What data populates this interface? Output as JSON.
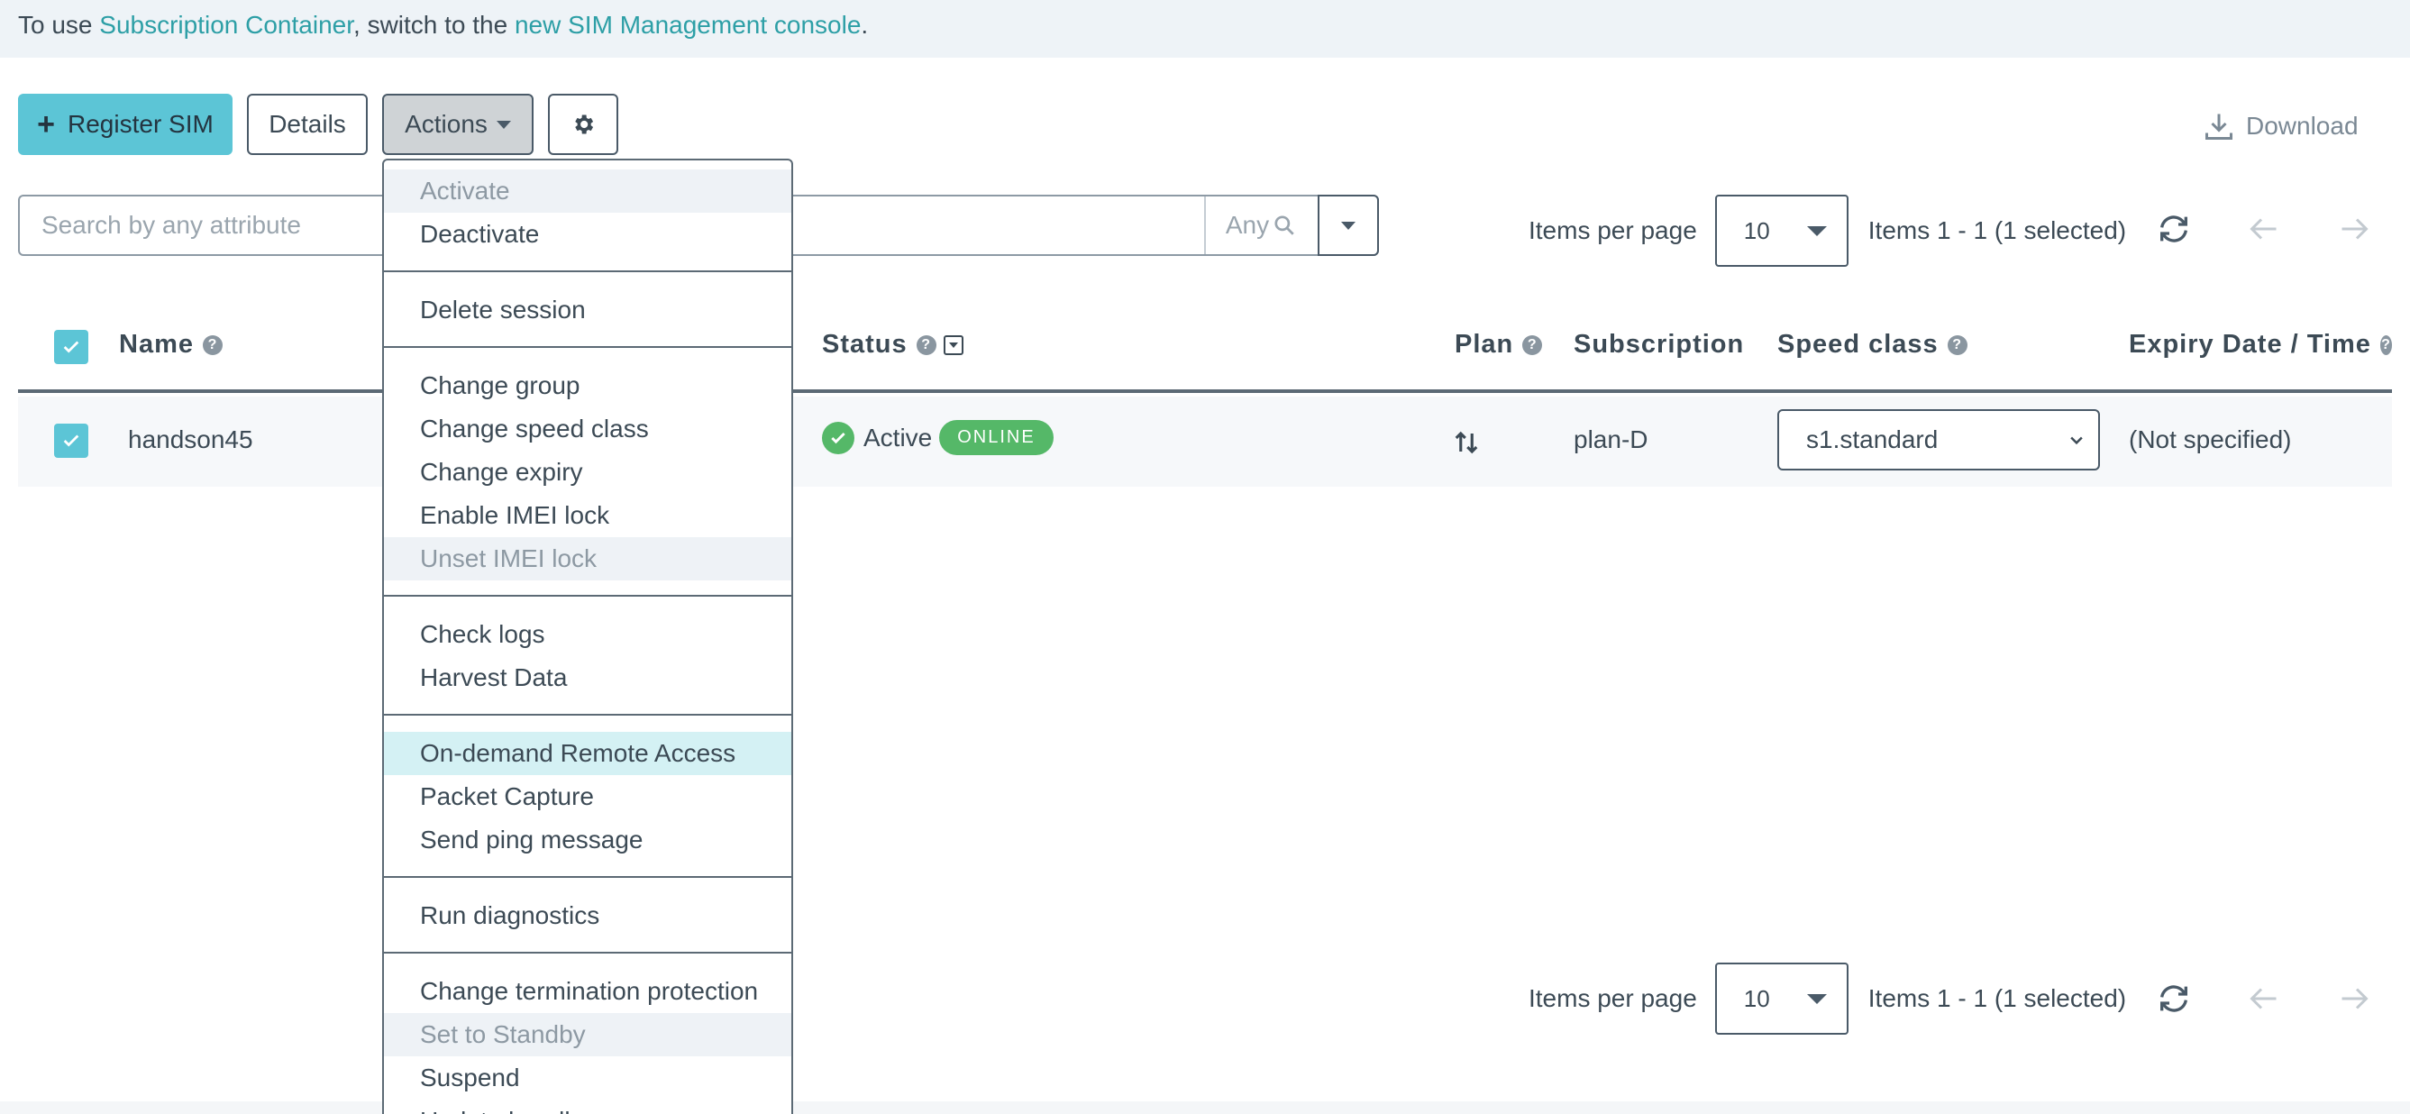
{
  "banner": {
    "prefix": "To use ",
    "link1": "Subscription Container",
    "middle": ", switch to the ",
    "link2": "new SIM Management console",
    "suffix": "."
  },
  "toolbar": {
    "register_label": "Register SIM",
    "details_label": "Details",
    "actions_label": "Actions",
    "download_label": "Download"
  },
  "search": {
    "placeholder": "Search by any attribute",
    "any_label": "Any"
  },
  "pager": {
    "items_per_page_label": "Items per page",
    "per_page_value": "10",
    "items_summary": "Items 1 - 1 (1 selected)"
  },
  "table": {
    "columns": {
      "name": "Name",
      "status": "Status",
      "plan": "Plan",
      "subscription": "Subscription",
      "speed_class": "Speed class",
      "expiry": "Expiry Date / Time"
    },
    "rows": [
      {
        "name": "handson45",
        "status": "Active",
        "online": "ONLINE",
        "subscription": "plan-D",
        "speed_class": "s1.standard",
        "expiry": "(Not specified)"
      }
    ]
  },
  "actions_menu": {
    "groups": [
      [
        "Activate",
        "Deactivate"
      ],
      [
        "Delete session"
      ],
      [
        "Change group",
        "Change speed class",
        "Change expiry",
        "Enable IMEI lock",
        "Unset IMEI lock"
      ],
      [
        "Check logs",
        "Harvest Data"
      ],
      [
        "On-demand Remote Access",
        "Packet Capture",
        "Send ping message"
      ],
      [
        "Run diagnostics"
      ],
      [
        "Change termination protection",
        "Set to Standby",
        "Suspend",
        "Update bundle"
      ]
    ]
  },
  "colors": {
    "accent": "#5cc5d6",
    "link": "#2d9fa6",
    "online_badge": "#55b868",
    "menu_active": "#d4f1f4"
  }
}
